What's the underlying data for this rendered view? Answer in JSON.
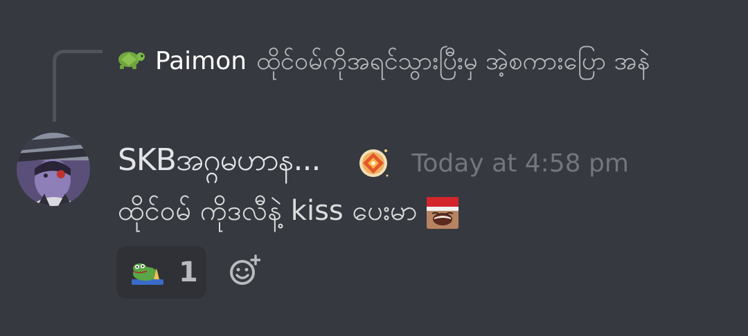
{
  "reply": {
    "icon": "turtle-emoji-icon",
    "author": "Paimon",
    "text": "ထိုင်ဝမ်ကိုအရင်သွားပြီးမှ အဲ့စကားပြော အနဲ"
  },
  "message": {
    "avatar": "anime-character-avatar",
    "username": "SKBအဂ္ဂမဟာန...",
    "role_badge": "orange-diamond-badge-icon",
    "timestamp": "Today at 4:58 pm",
    "text": "ထိုင်ဝမ် ကိုဒလီနဲ့ kiss ပေးမာ",
    "emoji": "laughing-santa-hat-emoji-icon"
  },
  "reactions": [
    {
      "emoji": "praying-pepe-emoji-icon",
      "count": "1"
    }
  ],
  "add_reaction_icon": "add-reaction-icon",
  "colors": {
    "background": "#36393f",
    "reply_text": "#b9bbbe",
    "timestamp": "#72767d",
    "reaction_bg": "#2f3136"
  }
}
